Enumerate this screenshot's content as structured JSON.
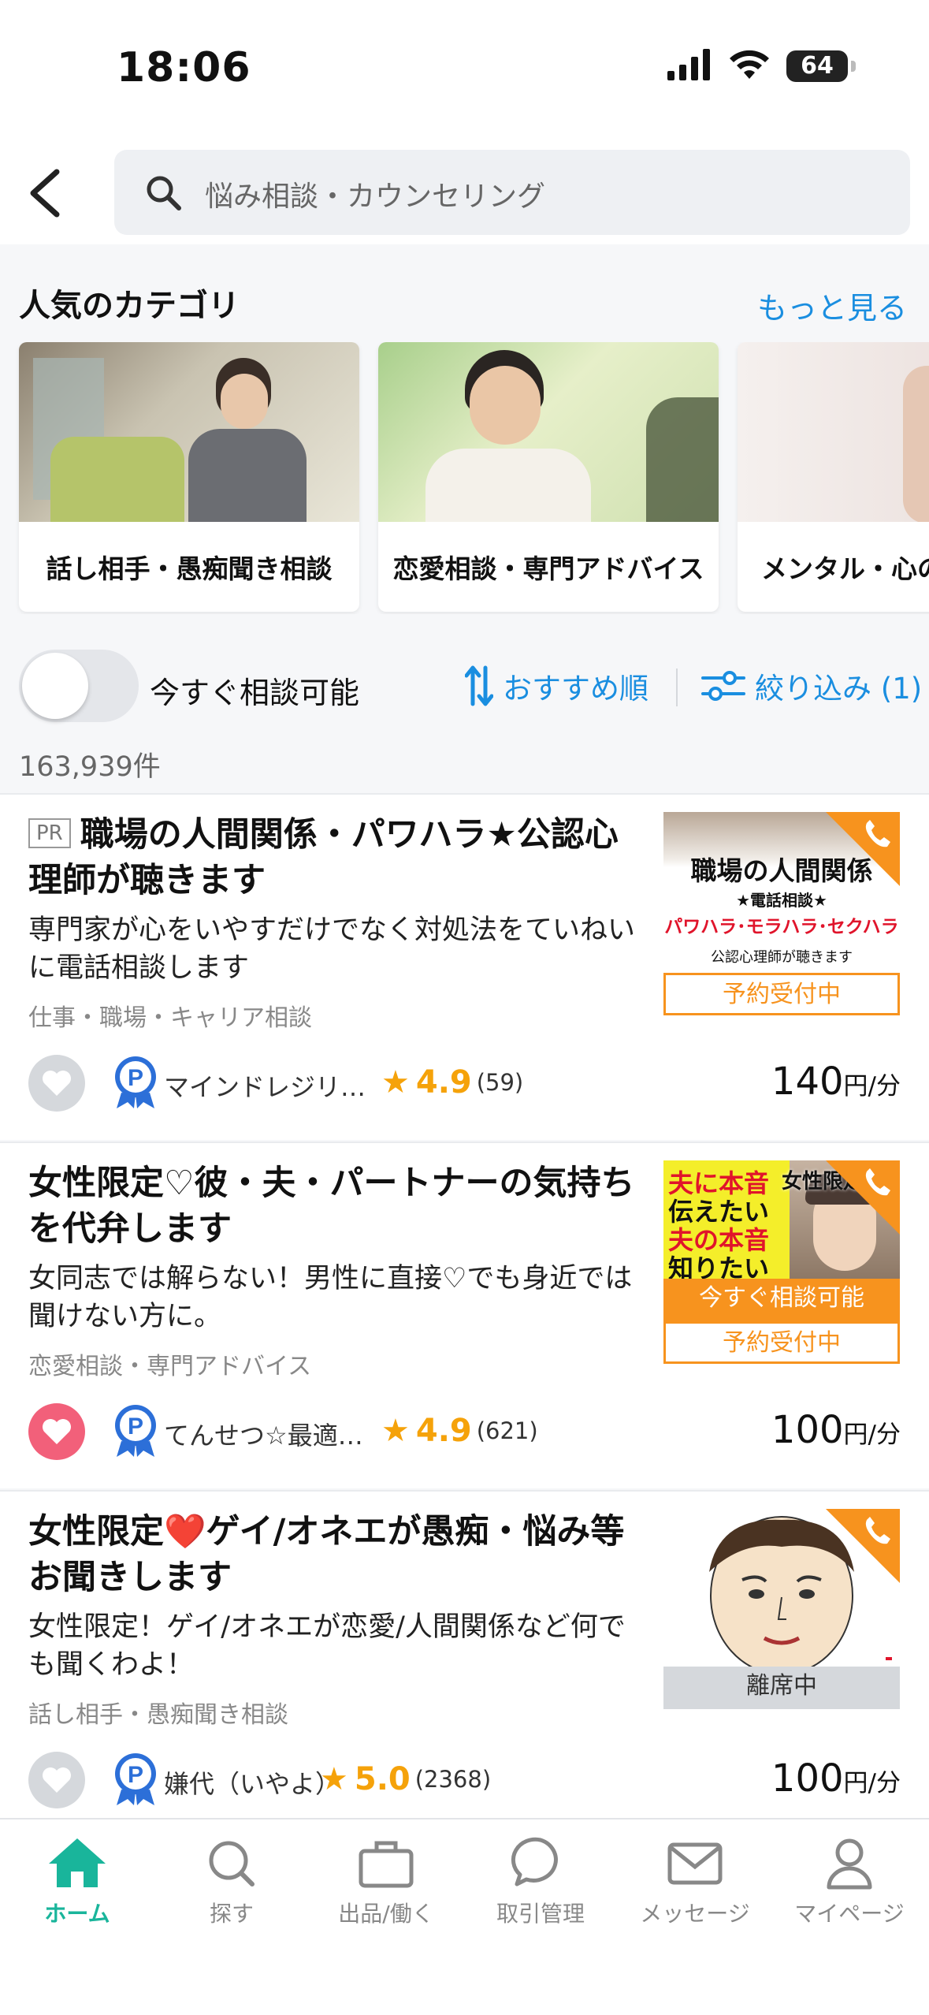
{
  "status_bar": {
    "time": "18:06",
    "battery": "64"
  },
  "search": {
    "placeholder": "悩み相談・カウンセリング"
  },
  "categories": {
    "title": "人気のカテゴリ",
    "more_label": "もっと見る",
    "items": [
      {
        "label": "話し相手・愚痴聞き相談"
      },
      {
        "label": "恋愛相談・専門アドバイス"
      },
      {
        "label": "メンタル・心の"
      }
    ]
  },
  "filters": {
    "toggle_label": "今すぐ相談可能",
    "sort_label": "おすすめ順",
    "filter_label": "絞り込み (1)",
    "result_count": "163,939件"
  },
  "listings": [
    {
      "pr": "PR",
      "title": "職場の人間関係・パワハラ★公認心理師が聴きます",
      "description": "専門家が心をいやすだけでなく対処法をていねいに電話相談します",
      "category": "仕事・職場・キャリア相談",
      "seller": "マインドレジリ…",
      "rating": "4.9",
      "reviews": "(59)",
      "price": "140",
      "price_unit": "円/分",
      "favorited": false,
      "thumb_lines": [
        "職場の人間関係",
        "★電話相談★",
        "パワハラ･モラハラ･セクハラ",
        "公認心理師が聴きます"
      ],
      "status_labels": [
        "予約受付中"
      ]
    },
    {
      "title": "女性限定♡彼・夫・パートナーの気持ちを代弁します",
      "description": "女同志では解らない！男性に直接♡でも身近では聞けない方に。",
      "category": "恋愛相談・専門アドバイス",
      "seller": "てんせつ☆最適…",
      "rating": "4.9",
      "reviews": "(621)",
      "price": "100",
      "price_unit": "円/分",
      "favorited": true,
      "thumb_lines": [
        "夫に本音",
        "伝えたい",
        "夫の本音",
        "知りたい",
        "女性限定"
      ],
      "status_labels": [
        "今すぐ相談可能",
        "予約受付中"
      ]
    },
    {
      "title": "女性限定❤️ゲイ/オネエが愚痴・悩み等お聞きします",
      "description": "女性限定！ゲイ/オネエが恋愛/人間関係など何でも聞くわよ！",
      "category": "話し相手・愚痴聞き相談",
      "seller": "嫌代（いやよ）",
      "rating": "5.0",
      "reviews": "(2368)",
      "price": "100",
      "price_unit": "円/分",
      "favorited": false,
      "status_labels": [
        "離席中"
      ]
    }
  ],
  "tabbar": [
    {
      "label": "ホーム",
      "icon": "home-icon",
      "active": true
    },
    {
      "label": "探す",
      "icon": "search-icon"
    },
    {
      "label": "出品/働く",
      "icon": "briefcase-icon"
    },
    {
      "label": "取引管理",
      "icon": "chat-bubble-icon"
    },
    {
      "label": "メッセージ",
      "icon": "envelope-icon"
    },
    {
      "label": "マイページ",
      "icon": "person-icon"
    }
  ],
  "colors": {
    "accent_blue": "#1a8ee0",
    "accent_orange": "#f7931e",
    "accent_green": "#19b59b",
    "heart_pink": "#f2607a"
  }
}
